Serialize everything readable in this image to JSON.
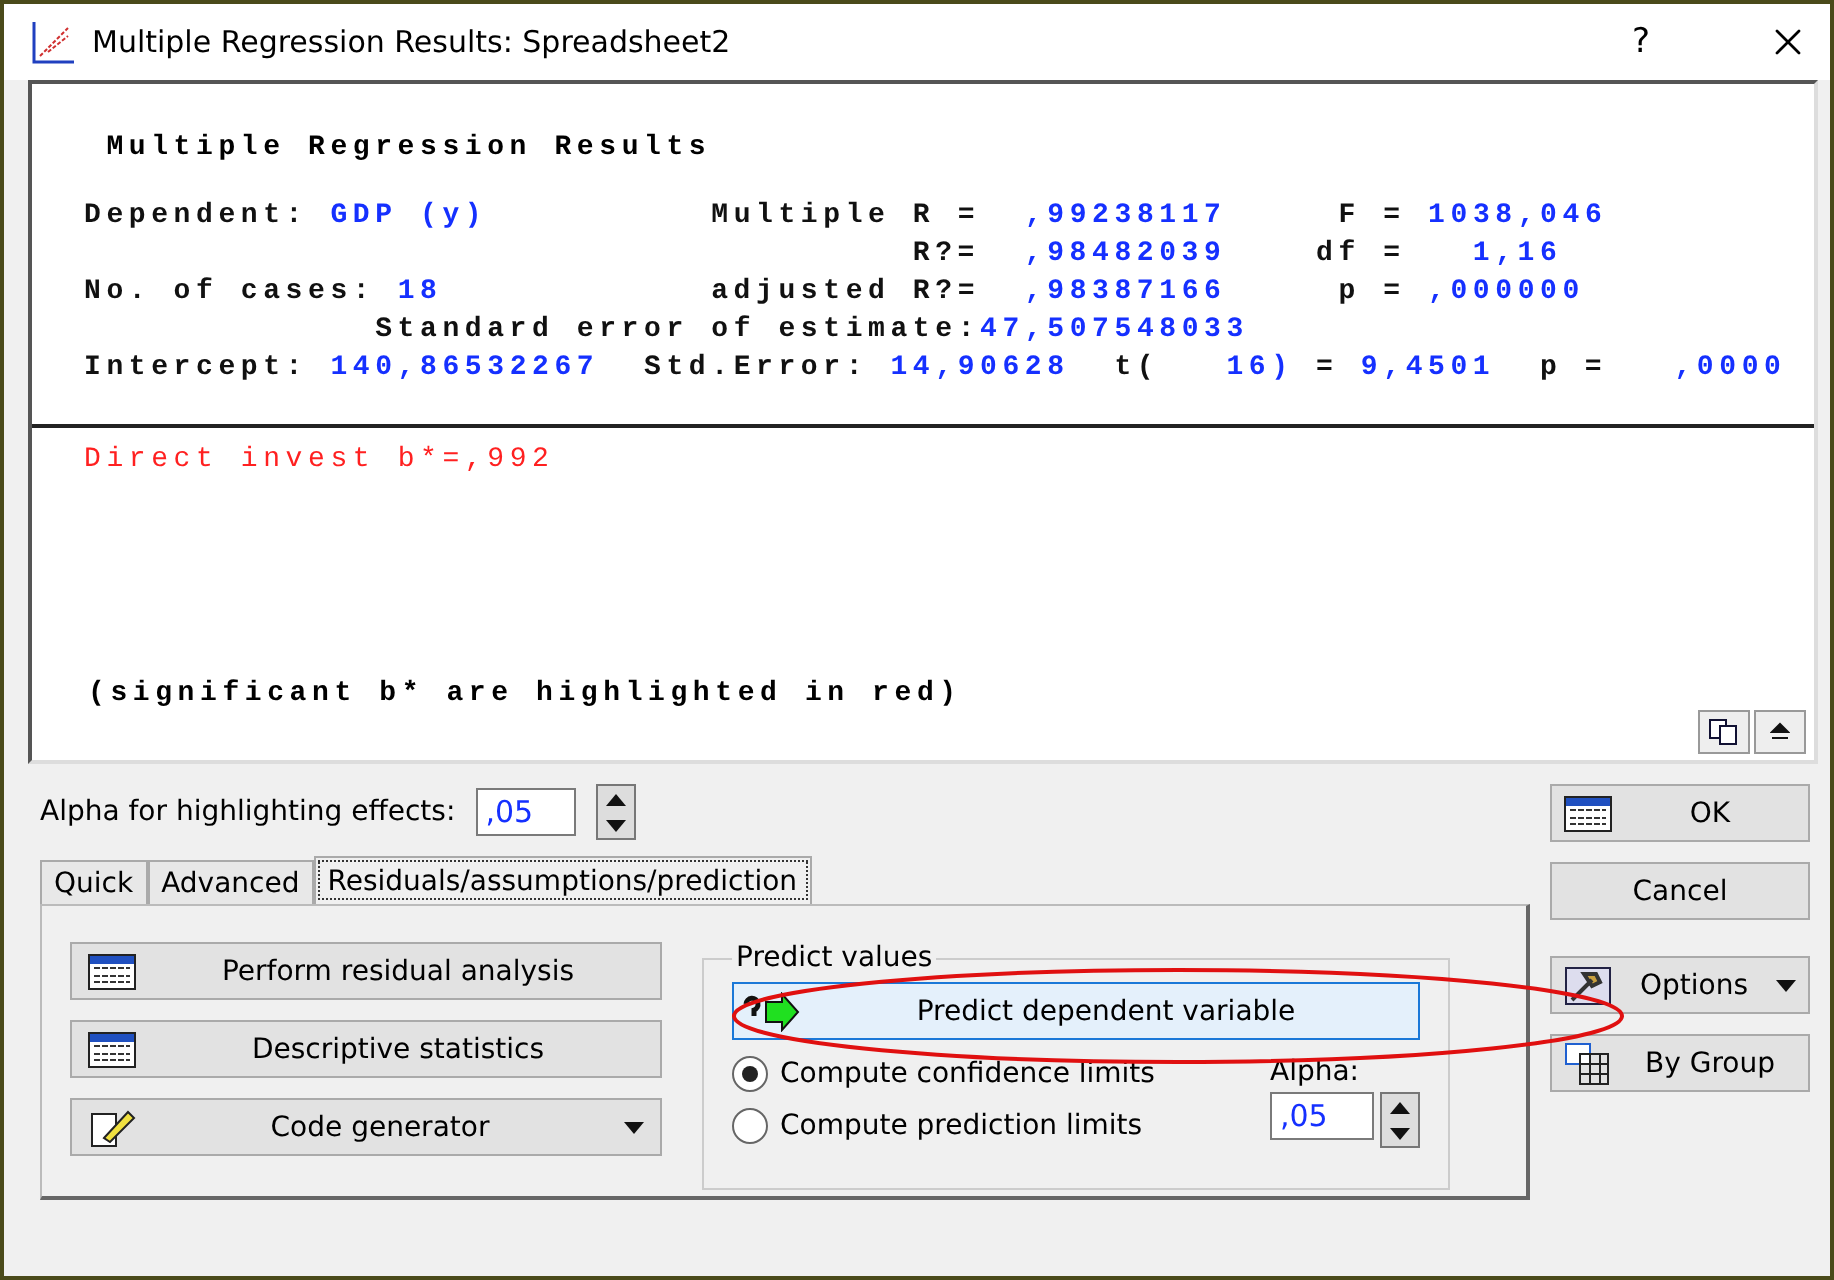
{
  "window": {
    "title": "Multiple Regression Results: Spreadsheet2",
    "help": "?"
  },
  "results": {
    "title": "Multiple Regression Results",
    "lines": [
      {
        "segments": [
          {
            "text": "Dependent:",
            "kind": "label"
          },
          {
            "text": "GDP (y)",
            "kind": "value"
          },
          {
            "text": "Multiple R =",
            "kind": "label"
          },
          {
            "text": ",99238117",
            "kind": "value"
          },
          {
            "text": "F =",
            "kind": "label"
          },
          {
            "text": "1038,046",
            "kind": "value"
          }
        ]
      },
      {
        "segments": [
          {
            "text": "R?=",
            "kind": "label"
          },
          {
            "text": ",98482039",
            "kind": "value"
          },
          {
            "text": "df =",
            "kind": "label"
          },
          {
            "text": "1,16",
            "kind": "value"
          }
        ]
      },
      {
        "segments": [
          {
            "text": "No. of cases:",
            "kind": "label"
          },
          {
            "text": "18",
            "kind": "value"
          },
          {
            "text": "adjusted R?=",
            "kind": "label"
          },
          {
            "text": ",98387166",
            "kind": "value"
          },
          {
            "text": "p =",
            "kind": "label"
          },
          {
            "text": ",000000",
            "kind": "value"
          }
        ]
      },
      {
        "segments": [
          {
            "text": "Standard error of estimate:",
            "kind": "label"
          },
          {
            "text": "47,507548033",
            "kind": "value"
          }
        ]
      },
      {
        "segments": [
          {
            "text": "Intercept:",
            "kind": "label"
          },
          {
            "text": "140,86532267",
            "kind": "value"
          },
          {
            "text": "Std.Error:",
            "kind": "label"
          },
          {
            "text": "14,90628",
            "kind": "value"
          },
          {
            "text": "t(",
            "kind": "label"
          },
          {
            "text": "16)",
            "kind": "value"
          },
          {
            "text": "=",
            "kind": "label"
          },
          {
            "text": "9,4501",
            "kind": "value"
          },
          {
            "text": "p =",
            "kind": "label"
          },
          {
            "text": ",0000",
            "kind": "value"
          }
        ]
      }
    ],
    "effects": [
      {
        "text": "Direct invest b*=,992",
        "significant": true
      }
    ],
    "note": "(significant b* are highlighted in red)"
  },
  "alpha": {
    "label": "Alpha for highlighting effects:",
    "value": ",05"
  },
  "tabs": [
    {
      "label": "Quick",
      "selected": false
    },
    {
      "label": "Advanced",
      "selected": false
    },
    {
      "label": "Residuals/assumptions/prediction",
      "selected": true
    }
  ],
  "actions": [
    {
      "label": "Perform residual analysis",
      "kind": "table"
    },
    {
      "label": "Descriptive statistics",
      "kind": "table"
    },
    {
      "label": "Code generator",
      "kind": "menu"
    }
  ],
  "predict": {
    "legend": "Predict values",
    "button": "Predict dependent variable",
    "options": [
      {
        "label": "Compute confidence limits",
        "selected": true
      },
      {
        "label": "Compute prediction limits",
        "selected": false
      }
    ],
    "alpha_label": "Alpha:",
    "alpha_value": ",05"
  },
  "side_buttons": [
    {
      "label": "OK",
      "kind": "table"
    },
    {
      "label": "Cancel",
      "kind": "plain"
    },
    {
      "label": "Options",
      "kind": "menu"
    },
    {
      "label": "By Group",
      "kind": "group"
    }
  ]
}
